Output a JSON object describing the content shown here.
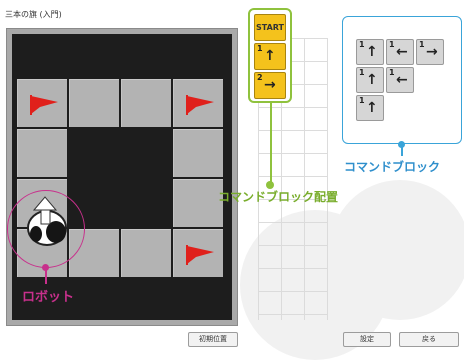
{
  "title": "三本の旗 (入門)",
  "board": {
    "colors": {
      "tile": "#b3b3b3",
      "background": "#1d1d1d",
      "frame": "#a9a9a9",
      "flag": "#e0201b"
    },
    "tiles": [
      {
        "row": 0,
        "col": 0,
        "flag": true
      },
      {
        "row": 0,
        "col": 1
      },
      {
        "row": 0,
        "col": 2
      },
      {
        "row": 0,
        "col": 3,
        "flag": true
      },
      {
        "row": 1,
        "col": 0
      },
      {
        "row": 1,
        "col": 3
      },
      {
        "row": 2,
        "col": 0
      },
      {
        "row": 2,
        "col": 3
      },
      {
        "row": 3,
        "col": 0,
        "robot": true
      },
      {
        "row": 3,
        "col": 1
      },
      {
        "row": 3,
        "col": 2
      },
      {
        "row": 3,
        "col": 3,
        "flag": true
      }
    ]
  },
  "labels": {
    "robot": "ロボット",
    "command_placement": "コマンドブロック配置",
    "command_block": "コマンドブロック"
  },
  "sequence": {
    "start_label": "START",
    "cards": [
      {
        "num": "1",
        "arrow": "↑"
      },
      {
        "num": "2",
        "arrow": "→"
      }
    ]
  },
  "commands": [
    {
      "num": "1",
      "arrow": "↑"
    },
    {
      "num": "1",
      "arrow": "←"
    },
    {
      "num": "1",
      "arrow": "→"
    },
    {
      "num": "1",
      "arrow": "↑"
    },
    {
      "num": "1",
      "arrow": "←"
    },
    {
      "num": "1",
      "arrow": "↑"
    }
  ],
  "buttons": {
    "reset_position": "初期位置",
    "settings": "設定",
    "back": "戻る"
  },
  "accent_colors": {
    "robot": "#c8308c",
    "placement": "#8fc23d",
    "command": "#3aa4d9",
    "start": "#f4c21c"
  }
}
